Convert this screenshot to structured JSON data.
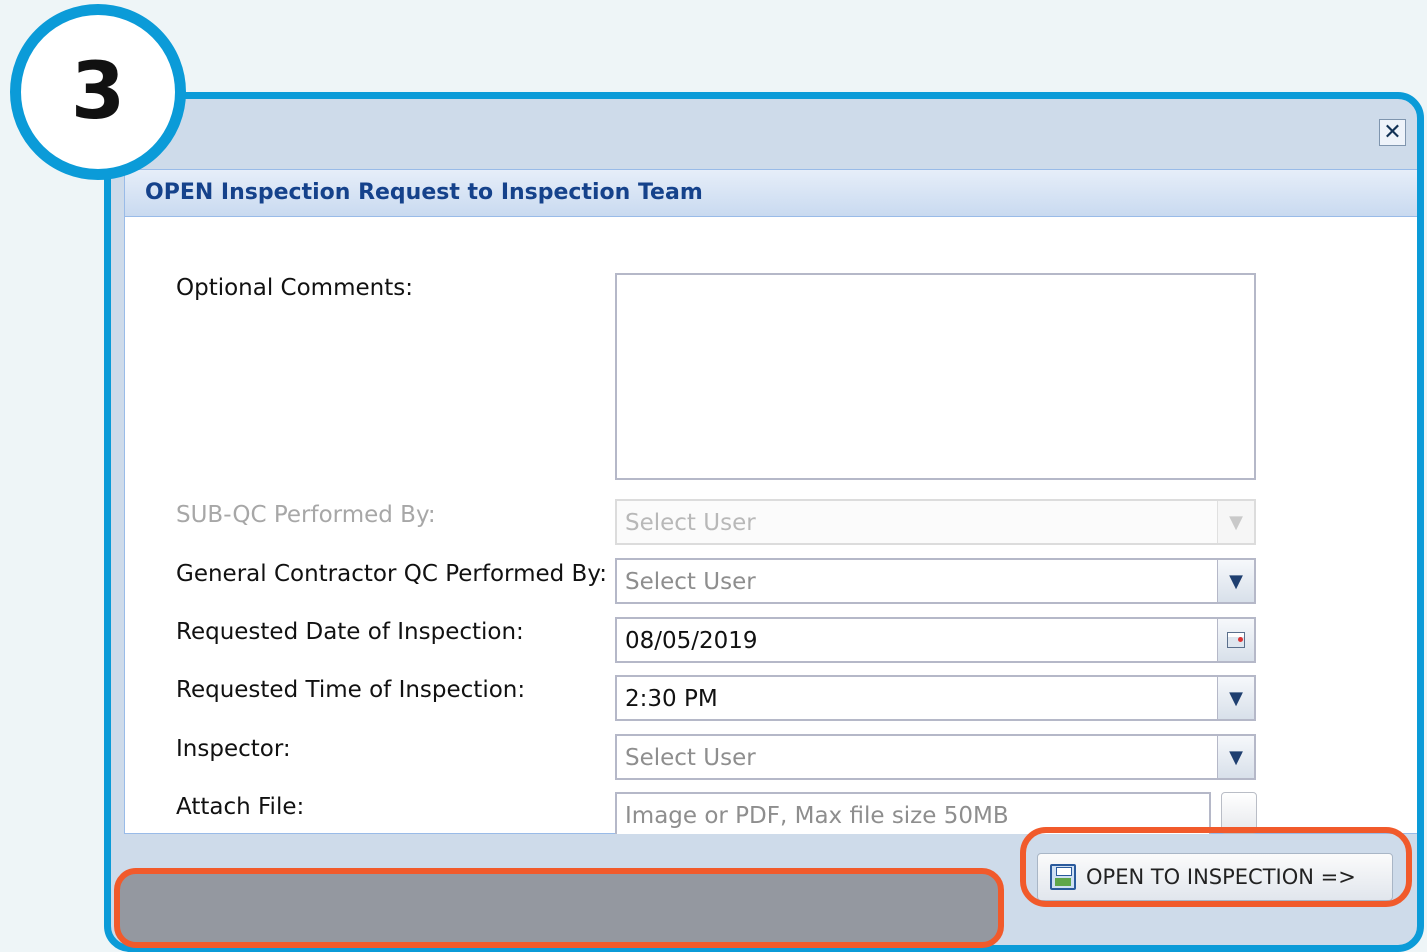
{
  "step_badge": {
    "number": "3"
  },
  "dialog": {
    "close_label": "✕",
    "title": "OPEN Inspection Request to Inspection Team",
    "fields": {
      "optional_comments": {
        "label": "Optional Comments:",
        "value": ""
      },
      "sub_qc": {
        "label": "SUB-QC Performed By:",
        "placeholder": "Select User",
        "disabled": true
      },
      "gc_qc": {
        "label": "General Contractor QC Performed By:",
        "placeholder": "Select User"
      },
      "requested_date": {
        "label": "Requested Date of Inspection:",
        "value": "08/05/2019"
      },
      "requested_time": {
        "label": "Requested Time of Inspection:",
        "value": "2:30 PM"
      },
      "inspector": {
        "label": "Inspector:",
        "placeholder": "Select User"
      },
      "attach_file": {
        "label": "Attach File:",
        "placeholder": "Image or PDF, Max file size 50MB"
      }
    },
    "dropdown_glyph": "▼",
    "open_button_label": "OPEN TO INSPECTION =>"
  },
  "colors": {
    "badge_ring": "#0b9bd8",
    "dialog_border": "#0b9bd8",
    "highlight_orange": "#f15a2b",
    "header_text": "#15428b"
  },
  "icons": {
    "close": "close-icon",
    "dropdown": "chevron-down-icon",
    "calendar": "calendar-icon",
    "save": "save-icon"
  }
}
